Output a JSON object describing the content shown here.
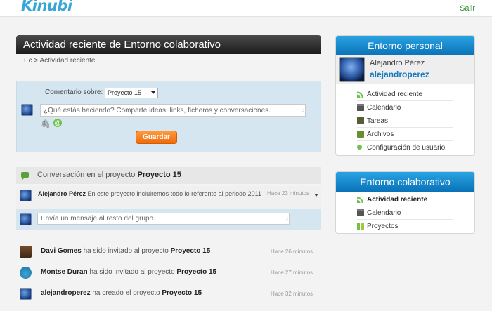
{
  "topbar": {
    "logo": "Kinubi",
    "logout_label": "Salir"
  },
  "main": {
    "title": "Actividad reciente de Entorno colaborativo",
    "breadcrumb": "Ec > Actividad reciente",
    "composer": {
      "about_label": "Comentario sobre:",
      "about_value": "Proyecto 15",
      "placeholder": "¿Qué estás haciendo? Comparte ideas, links, ficheros y conversaciones.",
      "save_label": "Guardar"
    },
    "conversation": {
      "prefix": "Conversación en el proyecto",
      "project": "Proyecto 15",
      "message": {
        "author": "Alejandro Pérez",
        "text": "En este proyecto incluiremos todo lo referente al periodo 2011",
        "time": "Hace 23 minutos"
      },
      "reply_placeholder": "Envía un mensaje al resto del grupo."
    },
    "activities": [
      {
        "user": "Davi Gomes",
        "action": "ha sido invitado al proyecto",
        "project": "Proyecto 15",
        "time": "Hace 26 minutos"
      },
      {
        "user": "Montse Duran",
        "action": "ha sido invitado al proyecto",
        "project": "Proyecto 15",
        "time": "Hace 27 minutos"
      },
      {
        "user": "alejandroperez",
        "action": "ha creado el proyecto",
        "project": "Proyecto 15",
        "time": "Hace 32 minutos"
      }
    ]
  },
  "personal_panel": {
    "title": "Entorno personal",
    "name": "Alejandro Pérez",
    "username": "alejandroperez",
    "items": [
      {
        "label": "Actividad reciente",
        "icon": "rss-icon"
      },
      {
        "label": "Calendario",
        "icon": "calendar-icon"
      },
      {
        "label": "Tareas",
        "icon": "tasks-icon"
      },
      {
        "label": "Archivos",
        "icon": "folder-icon"
      },
      {
        "label": "Configuración de usuario",
        "icon": "gear-icon"
      }
    ]
  },
  "collab_panel": {
    "title": "Entorno colaborativo",
    "items": [
      {
        "label": "Actividad reciente",
        "icon": "rss-icon",
        "active": true
      },
      {
        "label": "Calendario",
        "icon": "calendar-icon"
      },
      {
        "label": "Proyectos",
        "icon": "projects-icon"
      }
    ]
  },
  "colors": {
    "accent_blue": "#0a72b8",
    "save_orange": "#f06a0a",
    "link_green": "#2f8f2f"
  }
}
